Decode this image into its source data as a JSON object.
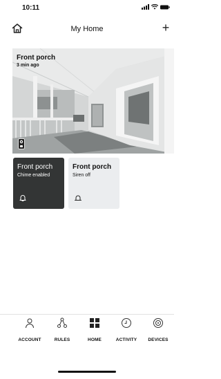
{
  "status": {
    "time": "10:11",
    "icons": [
      "signal-icon",
      "wifi-icon",
      "battery-icon"
    ]
  },
  "header": {
    "title": "My Home",
    "home_icon": "home-icon",
    "add_label": "+"
  },
  "camera": {
    "title": "Front porch",
    "subtitle": "3 min ago",
    "icon": "doorbell-icon"
  },
  "tiles": [
    {
      "title": "Front porch",
      "subtitle": "Chime enabled",
      "icon": "bell-icon",
      "theme": "dark"
    },
    {
      "title": "Front porch",
      "subtitle": "Siren off",
      "icon": "siren-icon",
      "theme": "light"
    }
  ],
  "tabs": [
    {
      "label": "ACCOUNT",
      "icon": "person-icon"
    },
    {
      "label": "RULES",
      "icon": "rules-icon"
    },
    {
      "label": "HOME",
      "icon": "grid-icon",
      "active": true
    },
    {
      "label": "ACTIVITY",
      "icon": "clock-icon"
    },
    {
      "label": "DEVICES",
      "icon": "devices-icon"
    }
  ],
  "colors": {
    "dark_tile": "#333535",
    "light_tile": "#ebedef",
    "text": "#111111"
  }
}
